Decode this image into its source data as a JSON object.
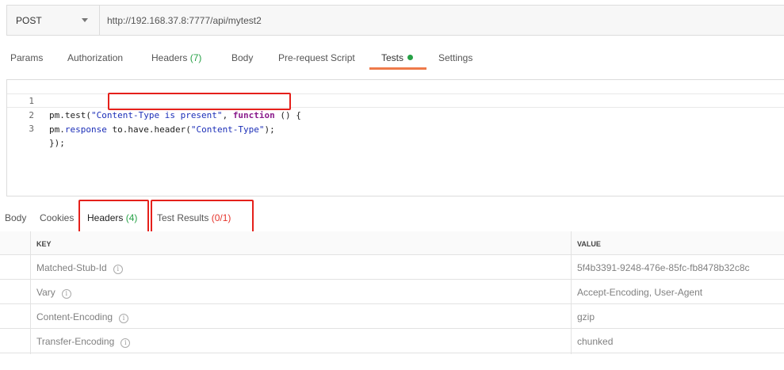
{
  "request": {
    "method": "POST",
    "url": "http://192.168.37.8:7777/api/mytest2"
  },
  "request_tabs": {
    "params": "Params",
    "authorization": "Authorization",
    "headers_label": "Headers",
    "headers_count": "(7)",
    "body": "Body",
    "pre_request_script": "Pre-request Script",
    "tests": "Tests",
    "settings": "Settings"
  },
  "editor": {
    "lines": [
      {
        "no": "1",
        "p1": "pm.test(",
        "p2": "\"Content-Type is present\"",
        "p3": ", ",
        "p4": "function",
        "p5": " () {"
      },
      {
        "no": "2",
        "p1": "pm.",
        "p2": "response",
        "p3": " to.have.header(",
        "p4": "\"Content-Type\"",
        "p5": ");"
      },
      {
        "no": "3",
        "p1": "});"
      }
    ]
  },
  "response_tabs": {
    "body": "Body",
    "cookies": "Cookies",
    "headers_label": "Headers",
    "headers_count": "(4)",
    "test_results_label": "Test Results",
    "test_results_count": "(0/1)"
  },
  "headers_table": {
    "col_key": "KEY",
    "col_value": "VALUE",
    "rows": [
      {
        "key": "Matched-Stub-Id",
        "value": "5f4b3391-9248-476e-85fc-fb8478b32c8c"
      },
      {
        "key": "Vary",
        "value": "Accept-Encoding, User-Agent"
      },
      {
        "key": "Content-Encoding",
        "value": "gzip"
      },
      {
        "key": "Transfer-Encoding",
        "value": "chunked"
      }
    ]
  },
  "colors": {
    "accent": "#ee7a4a",
    "green": "#26a146",
    "red": "#e5332a",
    "annotation": "#e5201b"
  },
  "icons": {
    "method_dropdown": "chevron-down-icon",
    "tests_status": "green-dot-icon",
    "header_info": "info-icon"
  }
}
